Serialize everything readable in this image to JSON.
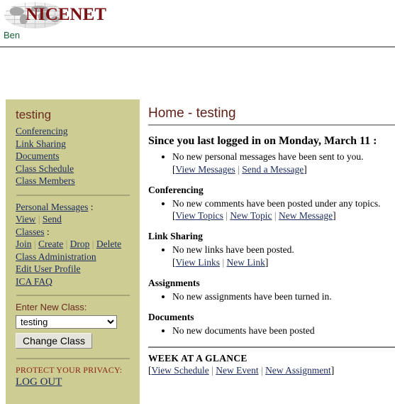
{
  "header": {
    "logo_text": "NICENET",
    "logo_icon": "globe-icon",
    "username": "Ben"
  },
  "sidebar": {
    "class_title": "testing",
    "nav_links": [
      {
        "label": "Conferencing"
      },
      {
        "label": "Link Sharing"
      },
      {
        "label": "Documents"
      },
      {
        "label": "Class Schedule"
      },
      {
        "label": "Class Members"
      }
    ],
    "personal_messages": {
      "label": "Personal Messages",
      "colon": " :",
      "actions": [
        "View",
        "Send"
      ],
      "separator": " | "
    },
    "classes": {
      "label": "Classes",
      "colon": " :",
      "actions": [
        "Join",
        "Create",
        "Drop",
        "Delete"
      ],
      "separator": " | "
    },
    "admin_links": [
      {
        "label": "Class Administration"
      },
      {
        "label": "Edit User Profile"
      },
      {
        "label": "ICA FAQ"
      }
    ],
    "enter_new_class": {
      "label": "Enter New Class:",
      "selected": "testing",
      "options": [
        "testing"
      ],
      "button_label": "Change Class"
    },
    "privacy": {
      "label": "PROTECT YOUR PRIVACY:",
      "logout_label": "LOG OUT"
    }
  },
  "main": {
    "title": "Home - testing",
    "since_heading": "Since you last logged in on Monday, March 11 :",
    "top_item": {
      "text": "No new personal messages have been sent to you.",
      "actions": [
        "View Messages",
        "Send a Message"
      ]
    },
    "sections": [
      {
        "heading": "Conferencing",
        "text": "No new comments have been posted under any topics.",
        "actions": [
          "View Topics",
          "New Topic",
          "New Message"
        ]
      },
      {
        "heading": "Link Sharing",
        "text": "No new links have been posted.",
        "actions": [
          "View Links",
          "New Link"
        ]
      },
      {
        "heading": "Assignments",
        "text": "No new assignments have been turned in.",
        "actions": []
      },
      {
        "heading": "Documents",
        "text": "No new documents have been posted",
        "actions": []
      }
    ],
    "week_at_a_glance": {
      "title": "WEEK AT A GLANCE",
      "actions": [
        "View Schedule",
        "New Event",
        "New Assignment"
      ]
    }
  },
  "colors": {
    "sidebar_bg": "#cccc93",
    "link": "#1b2a5e",
    "brand_red": "#7b1113",
    "heading_maroon": "#5e1f16",
    "username_green": "#16603a",
    "privacy_red": "#8f2216"
  }
}
